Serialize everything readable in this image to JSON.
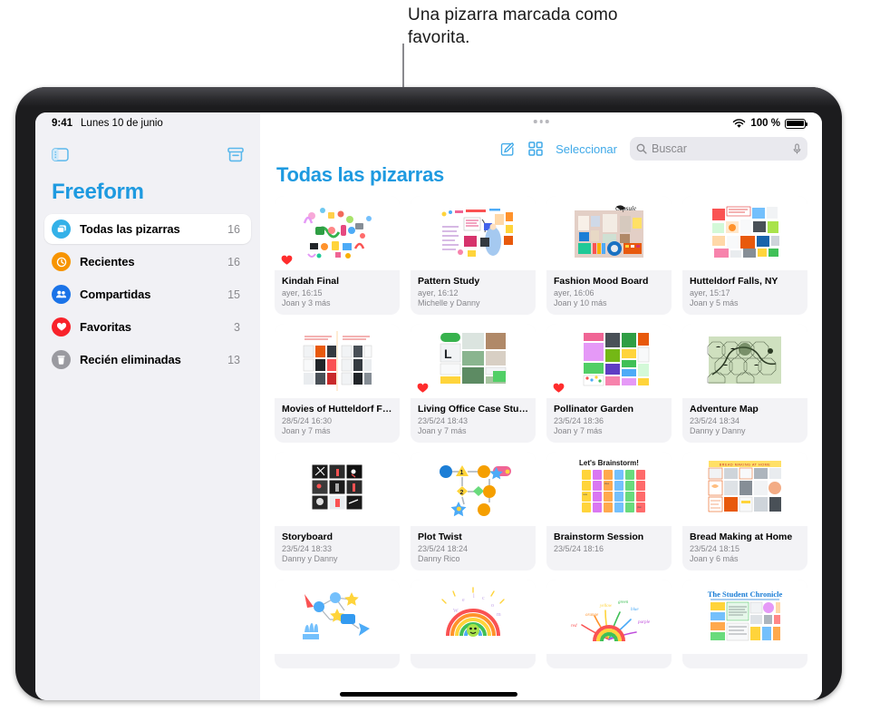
{
  "callout": {
    "text": "Una pizarra marcada como favorita."
  },
  "status_bar": {
    "time": "9:41",
    "date": "Lunes 10 de junio",
    "battery_percent": "100 %",
    "wifi_icon": "wifi-icon",
    "battery_icon": "battery-icon"
  },
  "sidebar": {
    "toggle_icon": "sidebar-toggle-icon",
    "archive_icon": "archive-box-icon",
    "app_title": "Freeform",
    "items": [
      {
        "label": "Todas las pizarras",
        "count": "16",
        "icon": "boards-icon",
        "color": "#34b1e8",
        "active": true
      },
      {
        "label": "Recientes",
        "count": "16",
        "icon": "clock-icon",
        "color": "#f79400",
        "active": false
      },
      {
        "label": "Compartidas",
        "count": "15",
        "icon": "people-icon",
        "color": "#1a73e8",
        "active": false
      },
      {
        "label": "Favoritas",
        "count": "3",
        "icon": "heart-icon",
        "color": "#f8232b",
        "active": false
      },
      {
        "label": "Recién eliminadas",
        "count": "13",
        "icon": "trash-icon",
        "color": "#9a9aa0",
        "active": false
      }
    ]
  },
  "toolbar": {
    "overflow_icon": "more-dots-icon",
    "compose_icon": "compose-icon",
    "grid_icon": "grid-view-icon",
    "select_label": "Seleccionar",
    "search_icon": "search-icon",
    "search_value": "",
    "search_placeholder": "Buscar",
    "mic_icon": "microphone-icon"
  },
  "main": {
    "page_title": "Todas las pizarras",
    "boards": [
      {
        "title": "Kindah Final",
        "date": "ayer, 16:15",
        "people": "Joan y 3 más",
        "favorite": true,
        "art": "doodle"
      },
      {
        "title": "Pattern Study",
        "date": "ayer, 16:12",
        "people": "Michelle y Danny",
        "favorite": false,
        "art": "pattern"
      },
      {
        "title": "Fashion Mood Board",
        "date": "ayer, 16:06",
        "people": "Joan y 10 más",
        "favorite": false,
        "art": "fashion"
      },
      {
        "title": "Hutteldorf Falls, NY",
        "date": "ayer, 15:17",
        "people": "Joan y 5 más",
        "favorite": false,
        "art": "collage"
      },
      {
        "title": "Movies of Hutteldorf Fa…",
        "date": "28/5/24 16:30",
        "people": "Joan y 7 más",
        "favorite": false,
        "art": "movies"
      },
      {
        "title": "Living Office Case Study",
        "date": "23/5/24 18:43",
        "people": "Joan y 7 más",
        "favorite": true,
        "art": "office"
      },
      {
        "title": "Pollinator Garden",
        "date": "23/5/24 18:36",
        "people": "Joan y 7 más",
        "favorite": true,
        "art": "garden"
      },
      {
        "title": "Adventure Map",
        "date": "23/5/24 18:34",
        "people": "Danny y Danny",
        "favorite": false,
        "art": "map"
      },
      {
        "title": "Storyboard",
        "date": "23/5/24 18:33",
        "people": "Danny y Danny",
        "favorite": false,
        "art": "storyboard"
      },
      {
        "title": "Plot Twist",
        "date": "23/5/24 18:24",
        "people": "Danny Rico",
        "favorite": false,
        "art": "plot"
      },
      {
        "title": "Brainstorm Session",
        "date": "23/5/24 18:16",
        "people": "",
        "favorite": false,
        "art": "brainstorm"
      },
      {
        "title": "Bread Making at Home",
        "date": "23/5/24 18:15",
        "people": "Joan y 6 más",
        "favorite": false,
        "art": "bread"
      },
      {
        "title": "",
        "date": "",
        "people": "",
        "favorite": false,
        "art": "mindmap"
      },
      {
        "title": "",
        "date": "",
        "people": "",
        "favorite": false,
        "art": "rainbow"
      },
      {
        "title": "",
        "date": "",
        "people": "",
        "favorite": false,
        "art": "burst"
      },
      {
        "title": "",
        "date": "",
        "people": "",
        "favorite": false,
        "art": "newspaper"
      }
    ],
    "brainstorm_caption": "Let's Brainstorm!",
    "newspaper_caption": "The Student Chronicle"
  },
  "home_indicator": "home-indicator"
}
